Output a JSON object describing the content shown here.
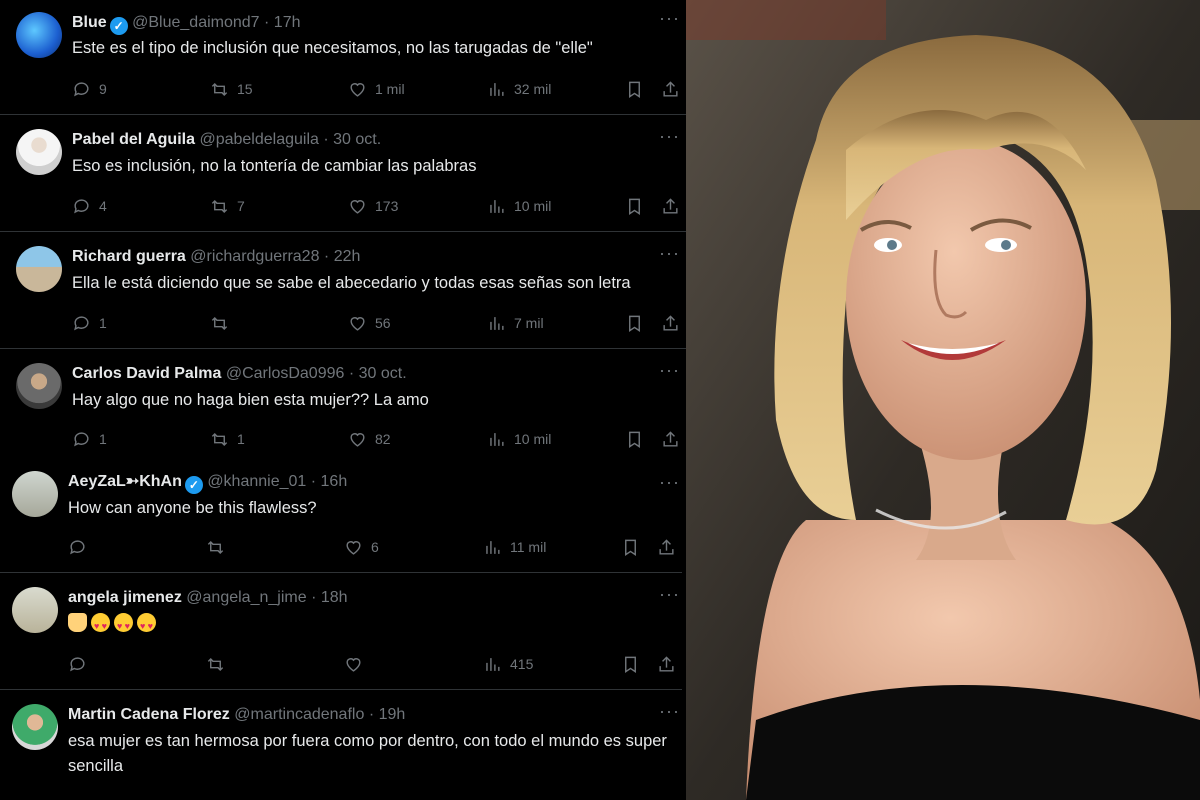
{
  "tweets": [
    {
      "name": "Blue",
      "verified": true,
      "handle": "@Blue_daimond7",
      "sep": "·",
      "time": "17h",
      "text": "Este es el tipo de inclusión que necesitamos, no las tarugadas de \"elle\"",
      "replies": "9",
      "reposts": "15",
      "likes": "1 mil",
      "views": "32 mil",
      "avatar": "blue-abstract"
    },
    {
      "name": "Pabel del Aguila",
      "verified": false,
      "handle": "@pabeldelaguila",
      "sep": "·",
      "time": "30 oct.",
      "text": "Eso es inclusión, no la tontería de cambiar las palabras",
      "replies": "4",
      "reposts": "7",
      "likes": "173",
      "views": "10 mil",
      "avatar": "man-white-shirt"
    },
    {
      "name": "Richard guerra",
      "verified": false,
      "handle": "@richardguerra28",
      "sep": "·",
      "time": "22h",
      "text": "Ella le está diciendo que se sabe el abecedario y todas esas señas son letra",
      "replies": "1",
      "reposts": "",
      "likes": "56",
      "views": "7 mil",
      "avatar": "beach-photo"
    },
    {
      "name": "Carlos David Palma",
      "verified": false,
      "handle": "@CarlosDa0996",
      "sep": "·",
      "time": "30 oct.",
      "text": "Hay algo que no haga bien esta mujer?? La amo",
      "replies": "1",
      "reposts": "1",
      "likes": "82",
      "views": "10 mil",
      "avatar": "man-portrait"
    },
    {
      "name": "AeyZaL➳KhAn",
      "verified": true,
      "handle": "@khannie_01",
      "sep": "·",
      "time": "16h",
      "text": "How can anyone be this flawless?",
      "replies": "",
      "reposts": "",
      "likes": "6",
      "views": "11 mil",
      "avatar": "person-outdoors"
    },
    {
      "name": "angela jimenez",
      "verified": false,
      "handle": "@angela_n_jime",
      "sep": "·",
      "time": "18h",
      "text": "",
      "emojis": [
        "raised-hands",
        "heart-eyes",
        "heart-eyes",
        "heart-eyes"
      ],
      "replies": "",
      "reposts": "",
      "likes": "",
      "views": "415",
      "avatar": "woman-outdoors"
    },
    {
      "name": "Martin Cadena Florez",
      "verified": false,
      "handle": "@martincadenaflo",
      "sep": "·",
      "time": "19h",
      "text": "esa mujer es tan hermosa por fuera como por dentro, con todo el mundo es super sencilla",
      "replies": "",
      "reposts": "",
      "likes": "",
      "views": "",
      "avatar": "man-green-shirt"
    }
  ],
  "icons": {
    "more": "more-dots-icon",
    "reply": "reply-icon",
    "repost": "repost-icon",
    "like": "heart-icon",
    "views": "views-icon",
    "bookmark": "bookmark-icon",
    "share": "share-icon",
    "verified": "verified-badge-icon"
  },
  "more_glyph": "···",
  "verified_glyph": "✓",
  "colors": {
    "background": "#000000",
    "text": "#e7e9ea",
    "secondary": "#71767b",
    "verified": "#1d9bf0",
    "divider": "#2f3336"
  },
  "photo": {
    "subject": "smiling woman with long blonde hair in black strapless dress"
  }
}
